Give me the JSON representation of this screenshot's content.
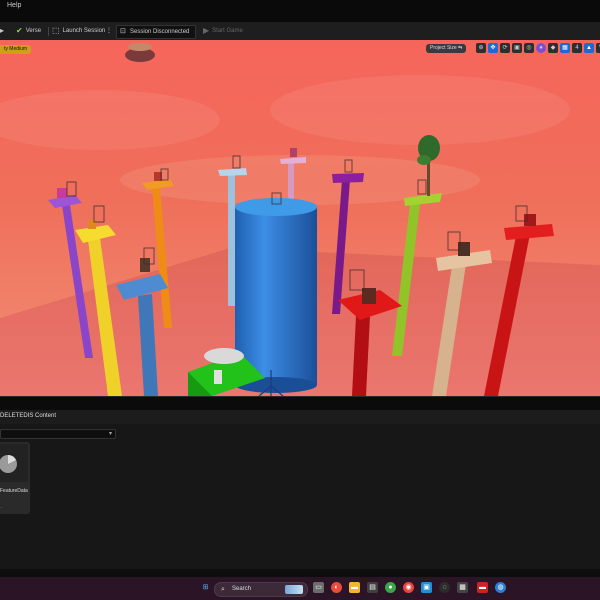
{
  "menubar": {
    "help": "Help"
  },
  "toolbar": {
    "verse": "Verse",
    "launch_session": "Launch Session",
    "session_status": "Session Disconnected",
    "start_game": "Start Game"
  },
  "viewport": {
    "quality_badge": "ty Medium",
    "project_size": "Project Size",
    "tools": [
      "⊕",
      "✥",
      "⟳",
      "▣",
      "◎",
      "●",
      "◆",
      "▦",
      "4",
      "▲",
      "W"
    ]
  },
  "content_browser": {
    "title": "DELETEDIS Content",
    "asset_name": "FeatureData",
    "asset_sub": "..."
  },
  "taskbar": {
    "search_label": "Search"
  },
  "colors": {
    "accent": "#1d6ad6",
    "quality_badge": "#c9a21a",
    "sky_top": "#f5665a",
    "sky_horizon": "#f39a7e"
  }
}
